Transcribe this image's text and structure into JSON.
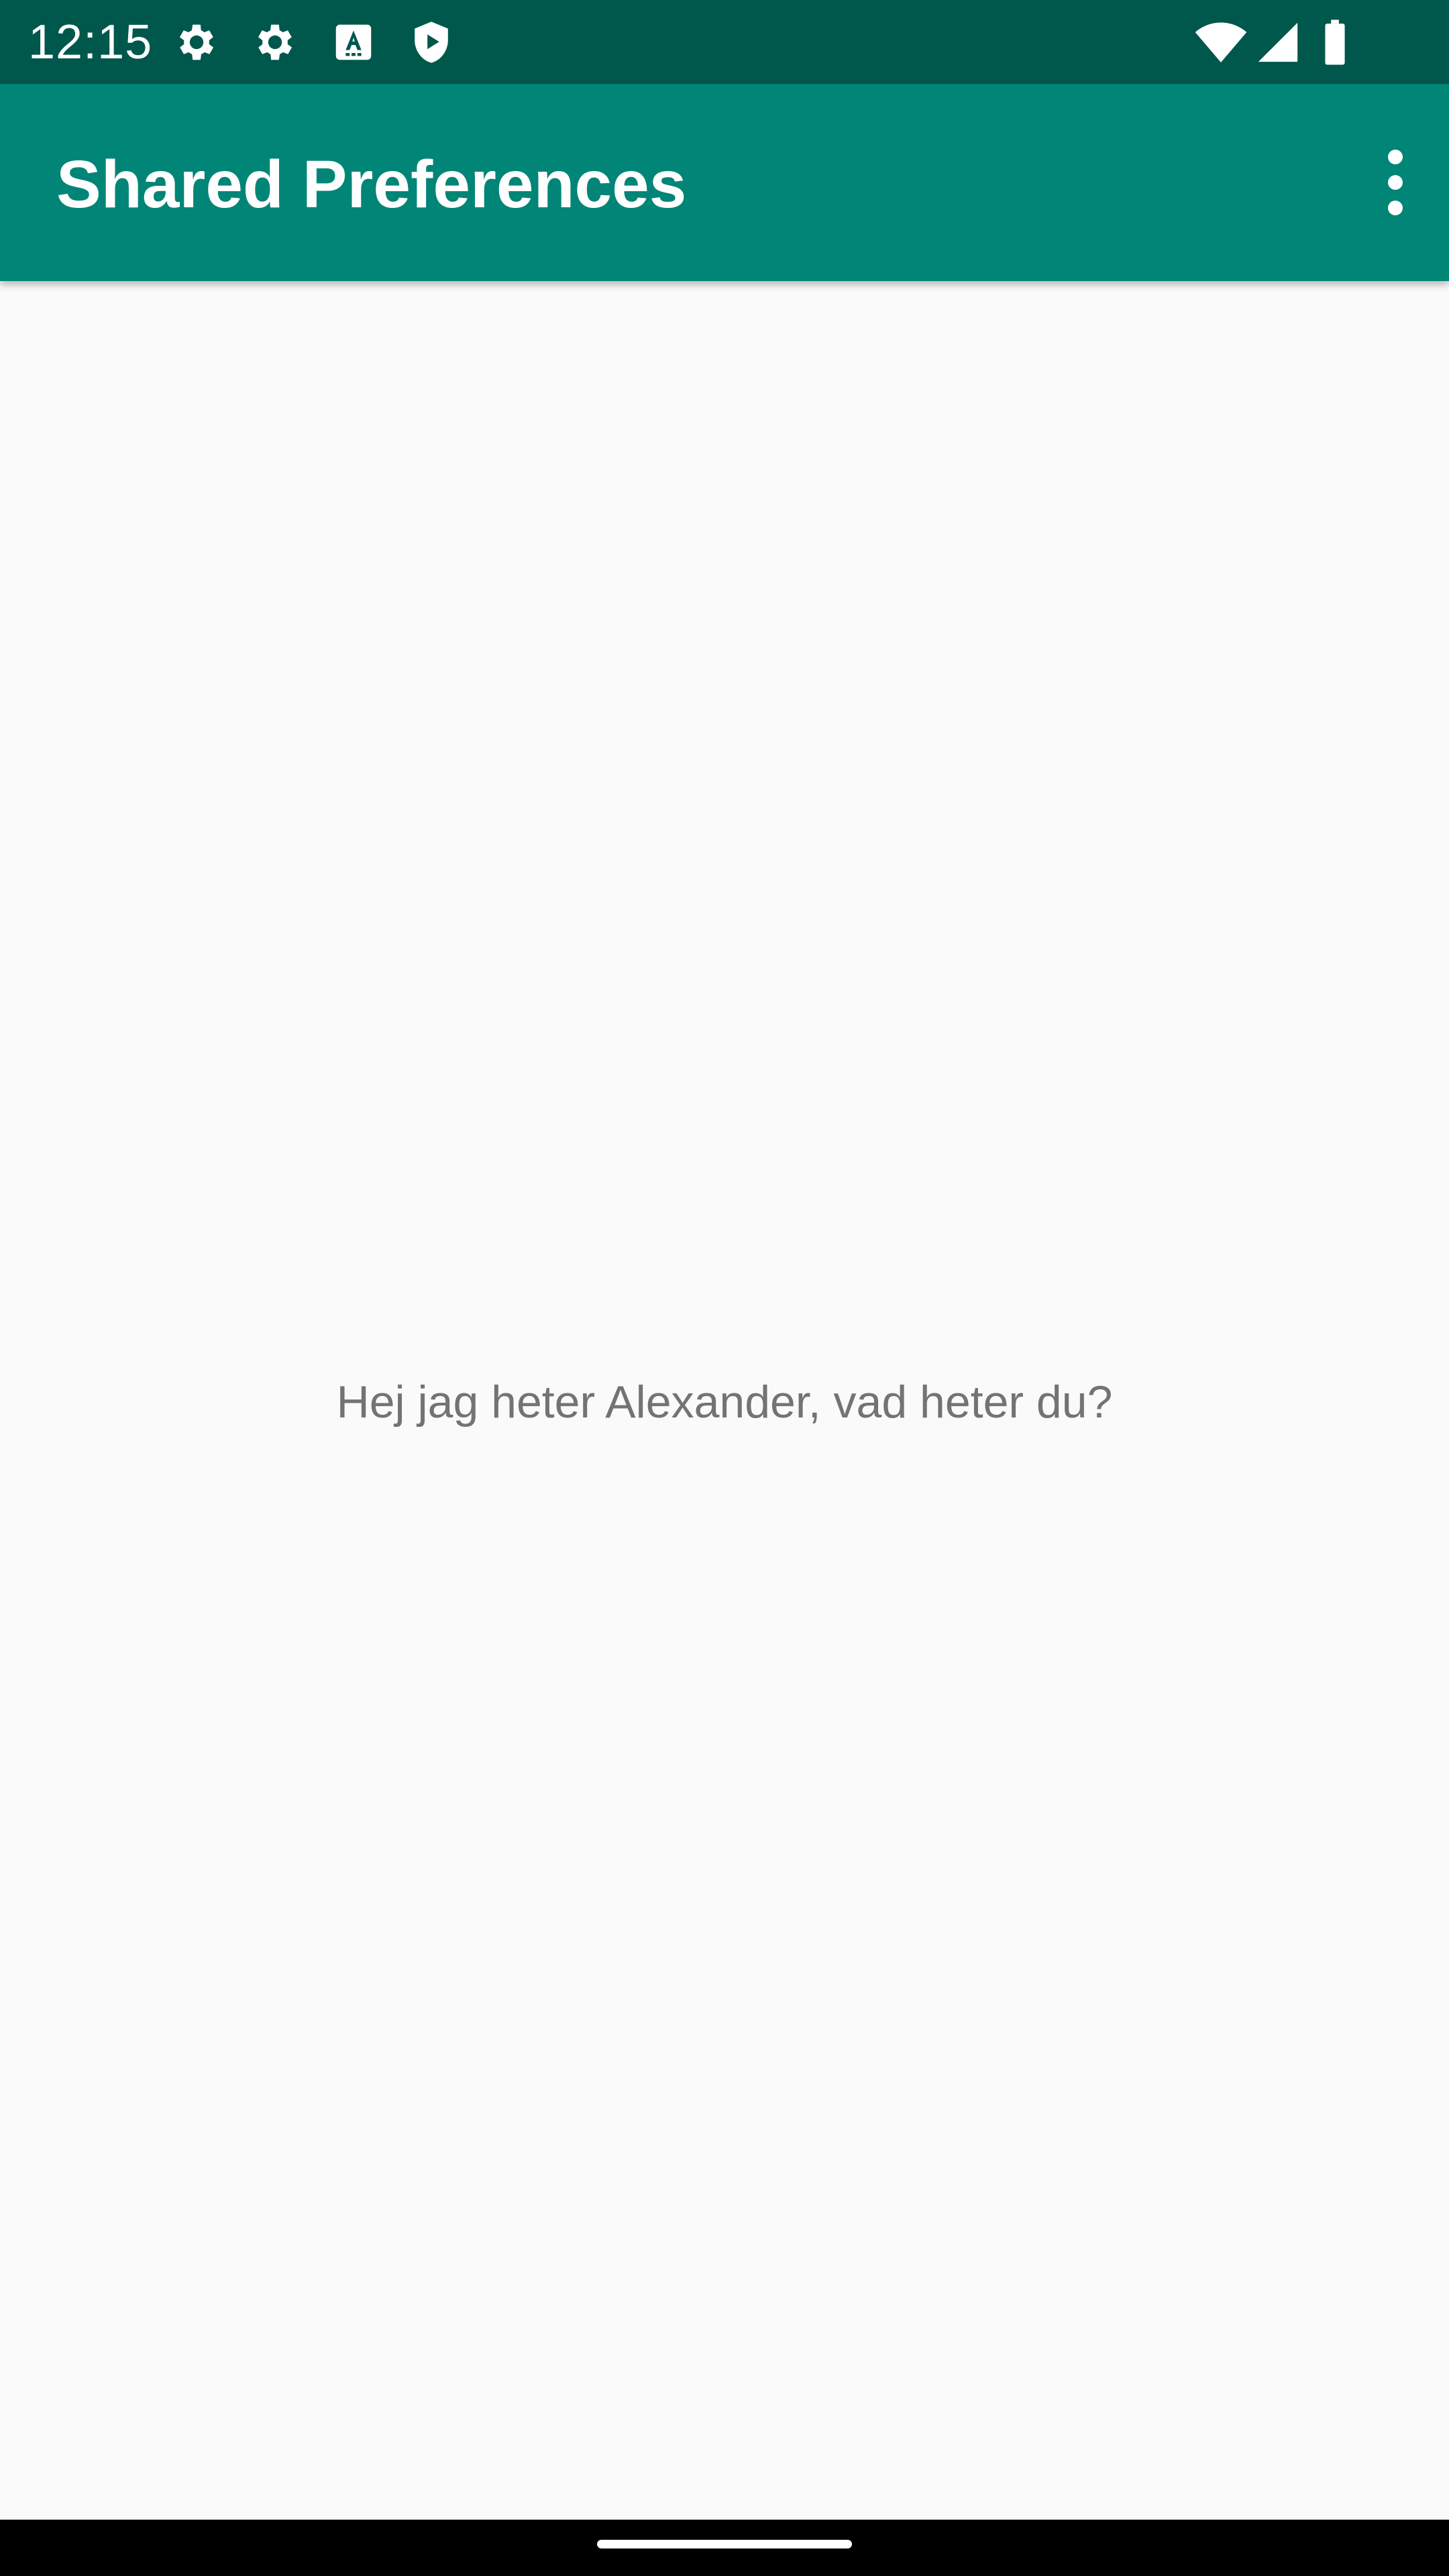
{
  "status_bar": {
    "time": "12:15",
    "icons": [
      "settings-icon",
      "settings-icon",
      "keyboard-a-icon",
      "shield-play-icon",
      "wifi-icon",
      "cellular-signal-icon",
      "battery-icon"
    ]
  },
  "app_bar": {
    "title": "Shared Preferences",
    "overflow_icon": "more-vert-icon"
  },
  "main": {
    "greeting": "Hej jag heter Alexander, vad heter du?"
  },
  "colors": {
    "status_bar": "#00574b",
    "app_bar": "#008577",
    "background": "#fafafa",
    "text_secondary": "#737373"
  }
}
